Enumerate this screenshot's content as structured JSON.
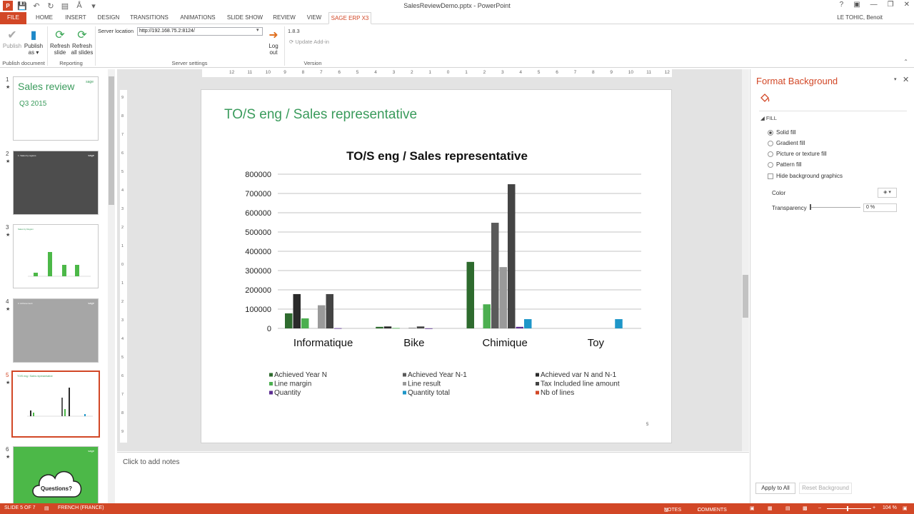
{
  "window": {
    "title": "SalesReviewDemo.pptx - PowerPoint",
    "user": "LE TOHIC, Benoit"
  },
  "tabs": [
    "FILE",
    "HOME",
    "INSERT",
    "DESIGN",
    "TRANSITIONS",
    "ANIMATIONS",
    "SLIDE SHOW",
    "REVIEW",
    "VIEW",
    "SAGE ERP X3"
  ],
  "ribbon": {
    "publish": "Publish",
    "publish_as_1": "Publish",
    "publish_as_2": "as ▾",
    "refresh_slide_1": "Refresh",
    "refresh_slide_2": "slide",
    "refresh_all_1": "Refresh",
    "refresh_all_2": "all slides",
    "server_label": "Server location",
    "server_value": "http://192.168.75.2:8124/",
    "logout_1": "Log",
    "logout_2": "out",
    "version": "1.8.3",
    "update_addin": "Update Add-in",
    "groups": {
      "publish_document": "Publish document",
      "reporting": "Reporting",
      "server_settings": "Server settings",
      "version": "Version"
    }
  },
  "thumbnails": {
    "numbers": [
      "1",
      "2",
      "3",
      "4",
      "5",
      "6"
    ],
    "star": "★",
    "s1_title": "Sales review",
    "s1_sub": "Q3 2015",
    "s2_title": "1. Sales by regions",
    "s3_title": "Sales by Region",
    "s4_title": "2. Achievement",
    "s5_title": "TO/S eng / Sales representative",
    "s6_text": "Questions?",
    "logo": "sage"
  },
  "hruler": [
    "12",
    "11",
    "10",
    "9",
    "8",
    "7",
    "6",
    "5",
    "4",
    "3",
    "2",
    "1",
    "0",
    "1",
    "2",
    "3",
    "4",
    "5",
    "6",
    "7",
    "8",
    "9",
    "10",
    "11",
    "12"
  ],
  "vruler": [
    "9",
    "8",
    "7",
    "6",
    "5",
    "4",
    "3",
    "2",
    "1",
    "0",
    "1",
    "2",
    "3",
    "4",
    "5",
    "6",
    "7",
    "8",
    "9"
  ],
  "slide": {
    "title": "TO/S eng / Sales representative",
    "number": "5"
  },
  "chart_data": {
    "type": "bar",
    "title": "TO/S eng / Sales representative",
    "categories": [
      "Informatique",
      "Bike",
      "Chimique",
      "Toy"
    ],
    "ylim": [
      0,
      800000
    ],
    "yticks": [
      "0",
      "100000",
      "200000",
      "300000",
      "400000",
      "500000",
      "600000",
      "700000",
      "800000"
    ],
    "grid": true,
    "legend_position": "bottom",
    "series": [
      {
        "name": "Achieved Year N",
        "color": "#2e6b2e",
        "values": [
          78000,
          8000,
          345000,
          0
        ]
      },
      {
        "name": "Achieved var N and N-1",
        "color": "#2a2a2a",
        "values": [
          178000,
          10000,
          0,
          0
        ]
      },
      {
        "name": "Line margin",
        "color": "#4caf50",
        "values": [
          52000,
          2000,
          125000,
          0
        ]
      },
      {
        "name": "Achieved Year N-1",
        "color": "#5a5a5a",
        "values": [
          0,
          0,
          548000,
          0
        ]
      },
      {
        "name": "Line result",
        "color": "#9a9a9a",
        "values": [
          120000,
          4000,
          318000,
          0
        ]
      },
      {
        "name": "Tax Included line amount",
        "color": "#444444",
        "values": [
          178000,
          10000,
          748000,
          0
        ]
      },
      {
        "name": "Quantity",
        "color": "#5c2d91",
        "values": [
          1000,
          300,
          8000,
          0
        ]
      },
      {
        "name": "Quantity total",
        "color": "#1e96c8",
        "values": [
          0,
          0,
          48000,
          48000
        ]
      },
      {
        "name": "Nb of lines",
        "color": "#d24726",
        "values": [
          0,
          0,
          0,
          0
        ]
      }
    ],
    "legend_items": [
      {
        "name": "Achieved Year N",
        "color": "#2e6b2e"
      },
      {
        "name": "Achieved Year N-1",
        "color": "#5a5a5a"
      },
      {
        "name": "Achieved var N and N-1",
        "color": "#2a2a2a"
      },
      {
        "name": "Line margin",
        "color": "#4caf50"
      },
      {
        "name": "Line result",
        "color": "#9a9a9a"
      },
      {
        "name": "Tax Included line amount",
        "color": "#444444"
      },
      {
        "name": "Quantity",
        "color": "#5c2d91"
      },
      {
        "name": "Quantity total",
        "color": "#1e96c8"
      },
      {
        "name": "Nb of lines",
        "color": "#d24726"
      }
    ]
  },
  "notes": {
    "placeholder": "Click to add notes"
  },
  "format_pane": {
    "title": "Format Background",
    "fill_header": "FILL",
    "options": [
      "Solid fill",
      "Gradient fill",
      "Picture or texture fill",
      "Pattern fill"
    ],
    "selected_option": "Solid fill",
    "hide_bg": "Hide background graphics",
    "color_label": "Color",
    "transparency_label": "Transparency",
    "transparency_value": "0 %",
    "transparency": 0,
    "apply_all": "Apply to All",
    "reset": "Reset Background"
  },
  "status": {
    "slide": "SLIDE 5 OF 7",
    "language": "FRENCH (FRANCE)",
    "notes": "NOTES",
    "comments": "COMMENTS",
    "zoom": "104 %"
  },
  "colors": {
    "accent": "#d24726",
    "title_green": "#3a9b5c",
    "thumb_green": "#4cb848",
    "thumb_dark": "#4d4d4d",
    "thumb_grey": "#a6a6a6"
  }
}
